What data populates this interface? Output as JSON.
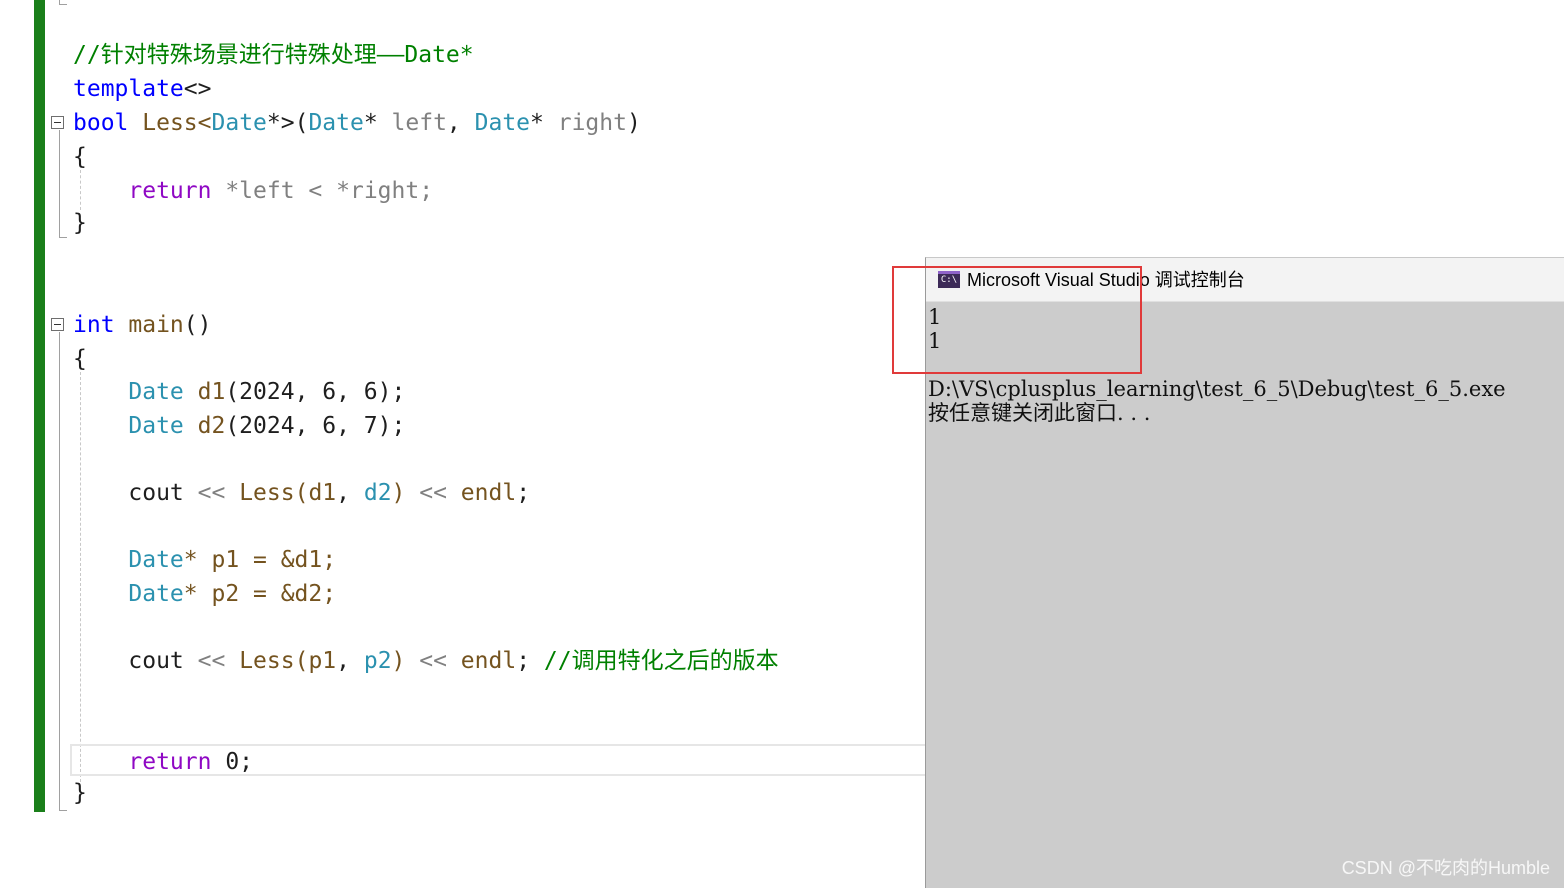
{
  "editor": {
    "lines": {
      "comment_date": "//针对特殊场景进行特殊处理——Date*",
      "template_kw": "template",
      "template_rest": "<>",
      "bool_kw": "bool",
      "less_fn": "Less",
      "lt": "<",
      "date_type": "Date",
      "gt_paren": "*>(",
      "star_sp": "* ",
      "left_param": "left",
      "comma_sp": ", ",
      "right_param": "right",
      "close_paren": ")",
      "open_brace": "{",
      "close_brace": "}",
      "return_kw": "return",
      "deref_left": " *left",
      "less_op": " < ",
      "deref_right": "*right;",
      "int_kw": "int",
      "main_fn": " main",
      "parens": "()",
      "d1_decl": " d1",
      "d1_args": "(2024, 6, 6);",
      "d2_decl": " d2",
      "d2_args": "(2024, 6, 7);",
      "cout": "cout ",
      "shift": "<<",
      "less_call_open": " Less(",
      "d1": "d1",
      "d2": "d2",
      "p1": "p1",
      "p2": "p2",
      "call_close": ") ",
      "endl": " endl",
      "semi": ";",
      "p1_decl": "* p1 = &d1;",
      "p2_decl": "* p2 = &d2;",
      "call_comment": " //调用特化之后的版本",
      "return_zero": " 0;"
    }
  },
  "console": {
    "title": "Microsoft Visual Studio 调试控制台",
    "icon_label": "C:\\",
    "output_line_1": "1",
    "output_line_2": "1",
    "exe_path": "D:\\VS\\cplusplus_learning\\test_6_5\\Debug\\test_6_5.exe",
    "press_key": "按任意键关闭此窗口. . ."
  },
  "watermark": "CSDN @不吃肉的Humble",
  "colors": {
    "keyword": "#0000ff",
    "return_keyword": "#8f08c4",
    "type": "#2b91af",
    "function": "#74531f",
    "parameter": "#808080",
    "comment": "#008000",
    "change_bar": "#1a7f1a",
    "highlight_box": "#e03a3a",
    "console_bg": "#cccccc"
  },
  "icons": [
    "console-app-icon",
    "fold-toggle-icon"
  ]
}
